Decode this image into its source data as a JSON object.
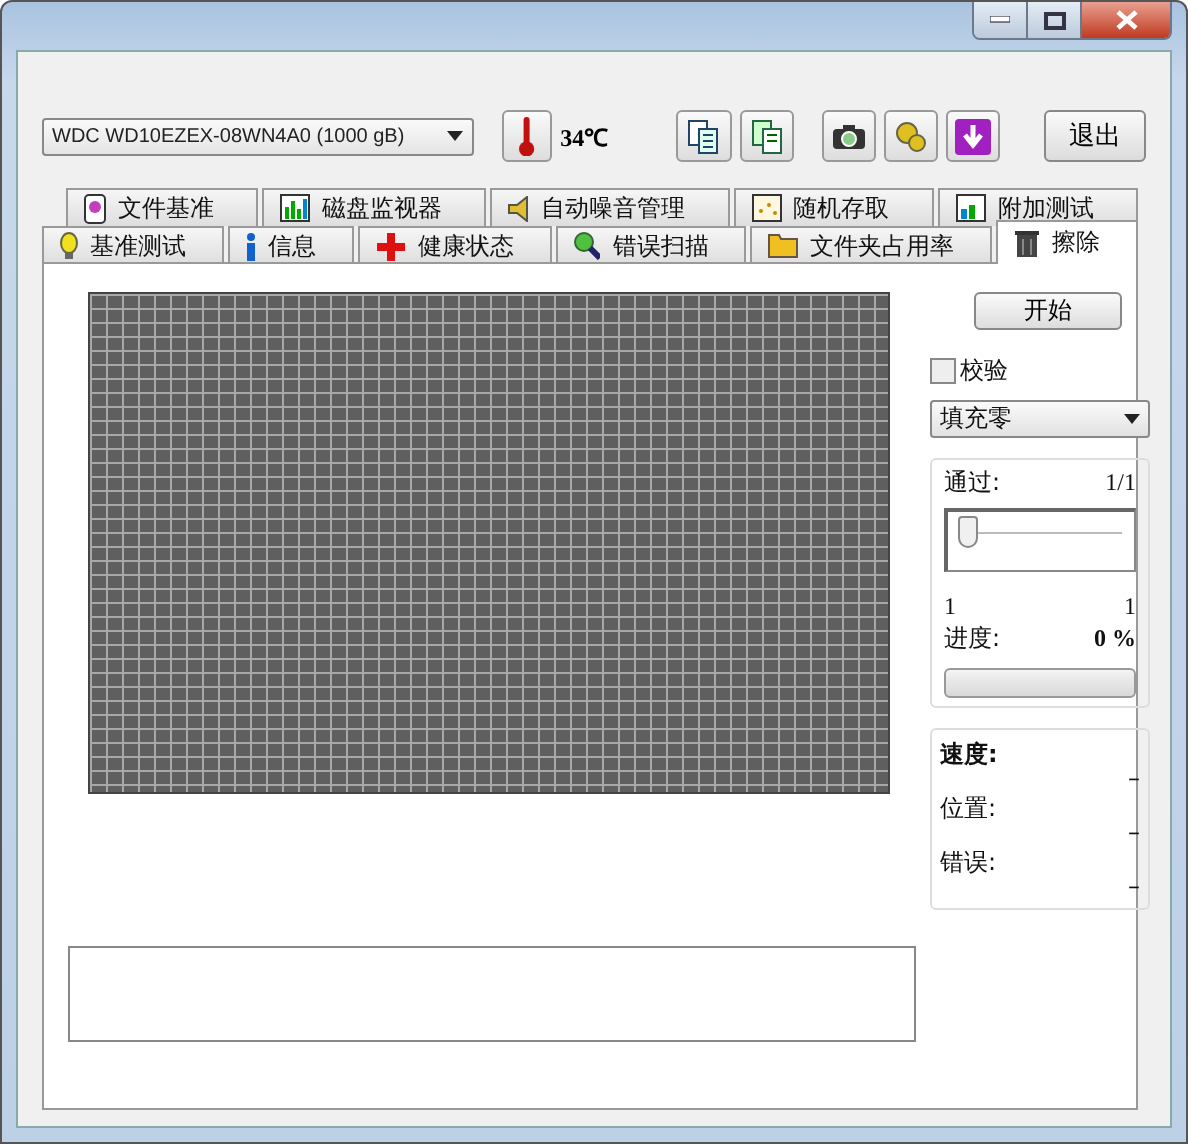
{
  "toolbar": {
    "drive": "WDC WD10EZEX-08WN4A0 (1000 gB)",
    "temperature": "34℃",
    "exit_button": "退出"
  },
  "tab_rows": [
    {
      "tabs": [
        {
          "label": "文件基准",
          "selected": false
        },
        {
          "label": "磁盘监视器",
          "selected": false
        },
        {
          "label": "自动噪音管理",
          "selected": false
        },
        {
          "label": "随机存取",
          "selected": false
        },
        {
          "label": "附加测试",
          "selected": false
        }
      ]
    },
    {
      "tabs": [
        {
          "label": "基准测试",
          "selected": false
        },
        {
          "label": "信息",
          "selected": false
        },
        {
          "label": "健康状态",
          "selected": false
        },
        {
          "label": "错误扫描",
          "selected": false
        },
        {
          "label": "文件夹占用率",
          "selected": false
        },
        {
          "label": "擦除",
          "selected": true
        }
      ]
    }
  ],
  "erase": {
    "start_button": "开始",
    "verify": {
      "label": "校验",
      "checked": false
    },
    "method": "填充零",
    "passes": {
      "label": "通过:",
      "value": "1/1",
      "level": 0,
      "min": "1",
      "max": "1"
    },
    "progress": {
      "label": "进度:",
      "value": "0 %",
      "level": 0
    },
    "stats": [
      {
        "label": "速度:",
        "value": "–"
      },
      {
        "label": "位置:",
        "value": "–"
      },
      {
        "label": "错误:",
        "value": "–"
      }
    ]
  }
}
